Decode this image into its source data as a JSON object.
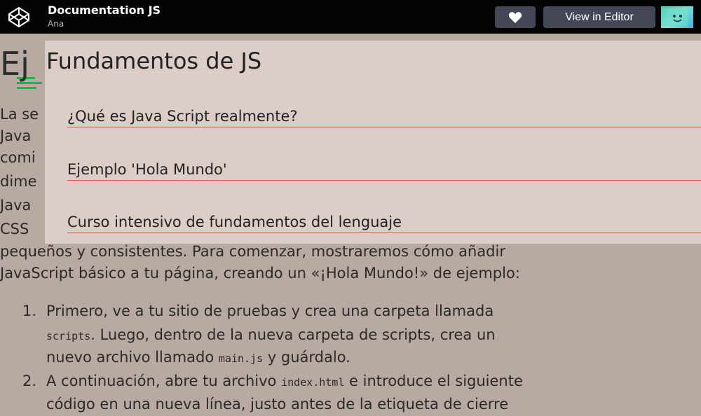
{
  "header": {
    "title": "Documentation JS",
    "author": "Ana",
    "heart_icon": "heart-icon",
    "editor_button": "View in Editor"
  },
  "nav": {
    "title": "Fundamentos de JS",
    "links": [
      "¿Qué es Java Script realmente?",
      "Ejemplo 'Hola Mundo'",
      "Curso intensivo de fundamentos del lenguaje"
    ]
  },
  "article": {
    "heading_partial": "Ej",
    "para_fragments": [
      "La se",
      "Java",
      "comi",
      "dime",
      "Java",
      "CSS"
    ],
    "para_line_1": "pequeños y consistentes. Para comenzar, mostraremos cómo añadir",
    "para_line_2": "JavaScript básico a tu página, creando un «¡Hola Mundo!» de ejemplo:",
    "list": [
      {
        "num": "1.",
        "line1": "Primero, ve a tu sitio de pruebas y crea una carpeta llamada",
        "code1": "scripts",
        "line2": ". Luego, dentro de la nueva carpeta de scripts, crea un",
        "line3a": "nuevo archivo llamado ",
        "code2": "main.js",
        "line3b": " y guárdalo."
      },
      {
        "num": "2.",
        "line1a": "A continuación, abre tu archivo ",
        "code1": "index.html",
        "line1b": " e introduce el siguiente",
        "line2": "código en una nueva línea, justo antes de la etiqueta de cierre"
      }
    ]
  },
  "colors": {
    "topbar": "#050505",
    "button": "#444856",
    "panel": "#dccdc8",
    "link_underline": "#c4643a",
    "page_bg": "#b8a9a3"
  }
}
